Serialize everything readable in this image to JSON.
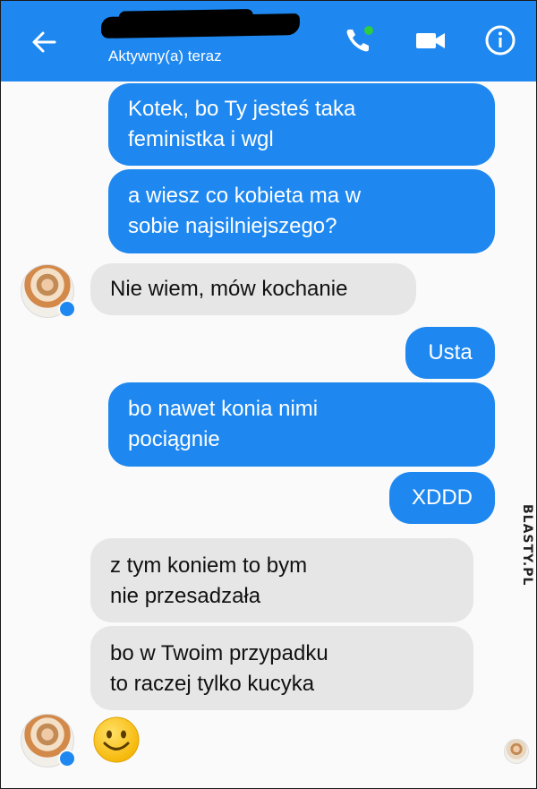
{
  "header": {
    "status": "Aktywny(a) teraz",
    "icons": [
      "back-arrow-icon",
      "phone-icon",
      "video-camera-icon",
      "info-icon"
    ],
    "accent_color": "#1e88f0",
    "online_dot_color": "#2ecc40"
  },
  "watermark": "BLASTY.PL",
  "messages": [
    {
      "side": "out",
      "text": "Kotek, bo Ty jesteś taka feministka i wgl"
    },
    {
      "side": "out",
      "text": "a wiesz co kobieta ma w sobie najsilniejszego?"
    },
    {
      "side": "in",
      "text": "Nie wiem, mów kochanie"
    },
    {
      "side": "out",
      "text": "Usta"
    },
    {
      "side": "out",
      "text": "bo nawet konia nimi pociągnie"
    },
    {
      "side": "out",
      "text": "XDDD"
    },
    {
      "side": "in",
      "text": "z tym koniem to bym nie przesadzała"
    },
    {
      "side": "in",
      "text": "bo w Twoim przypadku to raczej tylko kucyka"
    },
    {
      "side": "in",
      "emoji": "smiley-face-icon"
    }
  ],
  "lines": {
    "m0a": "Kotek, bo Ty jesteś taka",
    "m0b": "feministka i wgl",
    "m1a": "a wiesz co kobieta ma w",
    "m1b": "sobie najsilniejszego?",
    "m6a": "z tym koniem to bym",
    "m6b": "nie przesadzała",
    "m7a": "bo w Twoim przypadku",
    "m7b": "to raczej tylko kucyka",
    "m4a": "bo nawet konia nimi",
    "m4b": "pociągnie"
  }
}
